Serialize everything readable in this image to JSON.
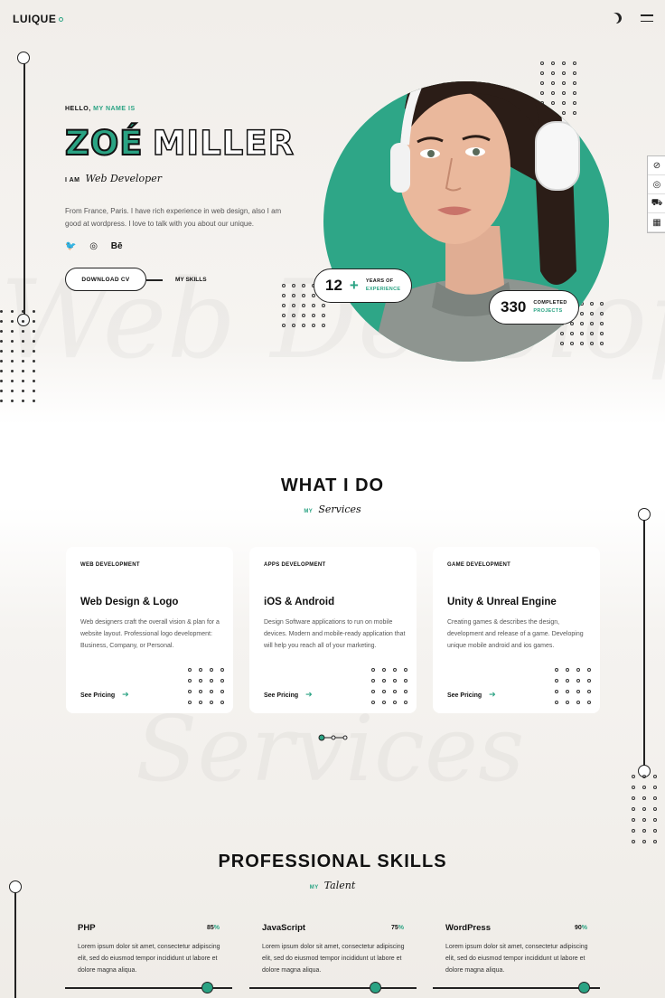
{
  "header": {
    "logo": "LUIQUE",
    "theme_icon": "moon-icon",
    "menu_icon": "hamburger-icon"
  },
  "hero": {
    "hello_prefix": "HELLO,",
    "hello_suffix": "MY NAME IS",
    "first_name": "ZOÉ",
    "last_name": "MILLER",
    "iam": "I AM",
    "role": "Web Developer",
    "intro": "From France, Paris. I have rich experience in web design, also I am good at wordpress. I love to talk with you about our unique.",
    "social": [
      {
        "name": "twitter-icon",
        "glyph": "🐦"
      },
      {
        "name": "dribbble-icon",
        "glyph": "◎"
      },
      {
        "name": "behance-icon",
        "glyph": "Bē"
      }
    ],
    "download_label": "DOWNLOAD CV",
    "skills_link": "MY SKILLS",
    "badge_years": {
      "num": "12",
      "plus": "+",
      "l1": "YEARS OF",
      "l2": "EXPERIENCE"
    },
    "badge_projects": {
      "num": "330",
      "l1": "COMPLETED",
      "l2": "PROJECTS"
    },
    "watermark": "Web Develope",
    "accent": "#2aa383"
  },
  "sidebar_icons": [
    {
      "name": "eye-off-icon",
      "glyph": "⊘"
    },
    {
      "name": "support-icon",
      "glyph": "◎"
    },
    {
      "name": "cart-icon",
      "glyph": "⛟"
    },
    {
      "name": "grid-icon",
      "glyph": "▦"
    }
  ],
  "services": {
    "title": "WHAT I DO",
    "sub_prefix": "MY",
    "sub_script": "Services",
    "watermark": "Services",
    "cards": [
      {
        "category": "WEB DEVELOPMENT",
        "title": "Web Design & Logo",
        "desc": "Web designers craft the overall vision & plan for a website layout. Professional logo development: Business, Company, or Personal.",
        "link": "See Pricing"
      },
      {
        "category": "APPS DEVELOPMENT",
        "title": "iOS & Android",
        "desc": "Design Software applications to run on mobile devices. Modern and mobile-ready application that will help you reach all of your marketing.",
        "link": "See Pricing"
      },
      {
        "category": "GAME DEVELOPMENT",
        "title": "Unity & Unreal Engine",
        "desc": "Creating games & describes the design, development and release of a game. Developing unique mobile android and ios games.",
        "link": "See Pricing"
      }
    ]
  },
  "skills": {
    "title": "PROFESSIONAL SKILLS",
    "sub_prefix": "MY",
    "sub_script": "Talent",
    "items": [
      {
        "name": "PHP",
        "pct": "85",
        "unit": "%",
        "level": 0.85,
        "desc": "Lorem ipsum dolor sit amet, consectetur adipiscing elit, sed do eiusmod tempor incididunt ut labore et dolore magna aliqua."
      },
      {
        "name": "JavaScript",
        "pct": "75",
        "unit": "%",
        "level": 0.75,
        "desc": "Lorem ipsum dolor sit amet, consectetur adipiscing elit, sed do eiusmod tempor incididunt ut labore et dolore magna aliqua."
      },
      {
        "name": "WordPress",
        "pct": "90",
        "unit": "%",
        "level": 0.9,
        "desc": "Lorem ipsum dolor sit amet, consectetur adipiscing elit, sed do eiusmod tempor incididunt ut labore et dolore magna aliqua."
      }
    ]
  }
}
